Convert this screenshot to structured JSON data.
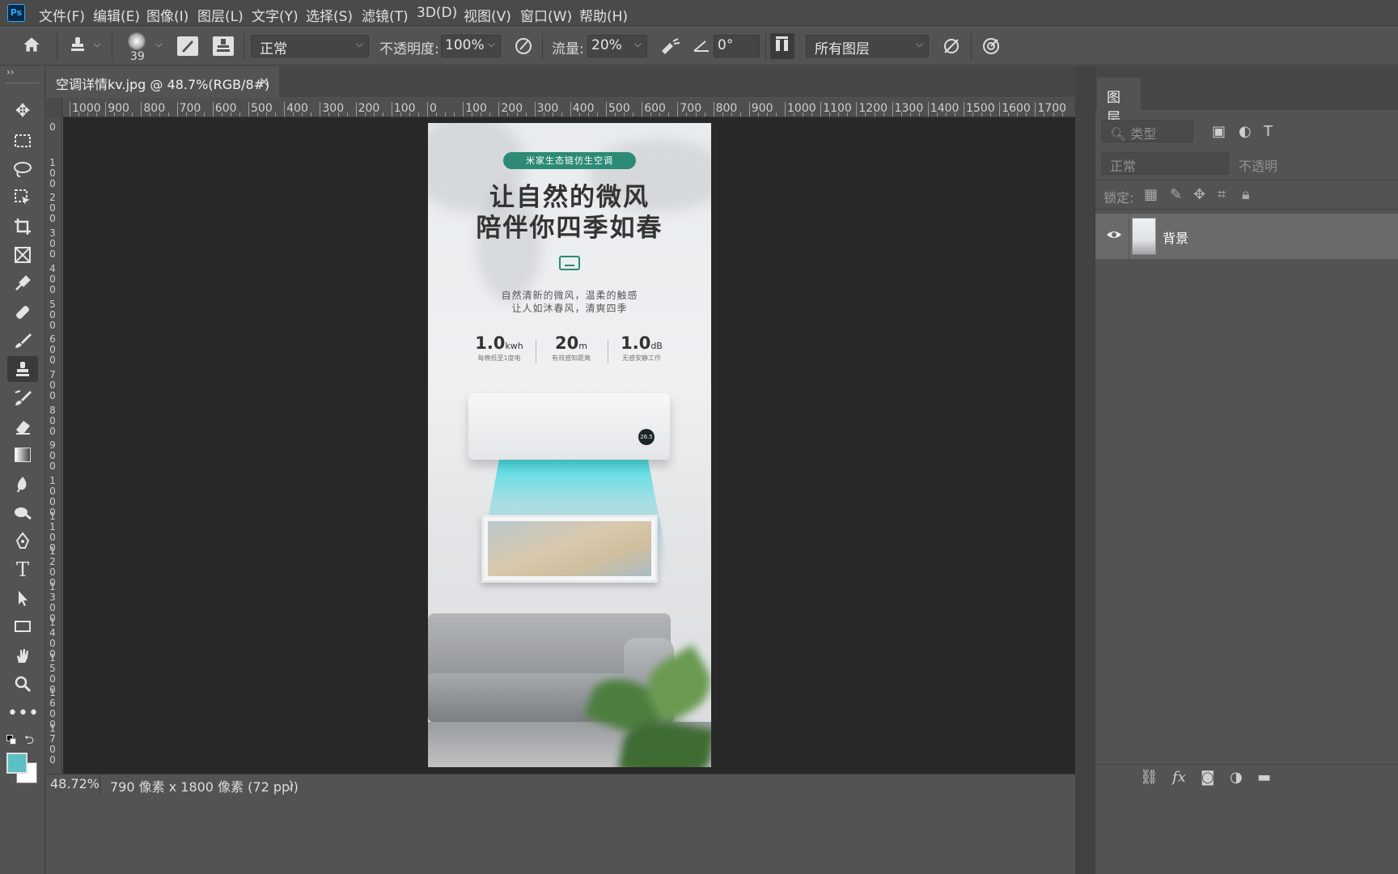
{
  "app": {
    "logo": "Ps",
    "accent": "#31a8ff"
  },
  "menu": [
    "文件(F)",
    "编辑(E)",
    "图像(I)",
    "图层(L)",
    "文字(Y)",
    "选择(S)",
    "滤镜(T)",
    "3D(D)",
    "视图(V)",
    "窗口(W)",
    "帮助(H)"
  ],
  "options": {
    "brush_size": "39",
    "mode": "正常",
    "opacity_label": "不透明度:",
    "opacity_value": "100%",
    "flow_label": "流量:",
    "flow_value": "20%",
    "angle_value": "0°",
    "sample": "所有图层"
  },
  "document": {
    "tab_title": "空调详情kv.jpg @ 48.7%(RGB/8#)",
    "close": "×"
  },
  "rulers": {
    "h_labels": [
      "1000",
      "900",
      "800",
      "700",
      "600",
      "500",
      "400",
      "300",
      "200",
      "100",
      "0",
      "100",
      "200",
      "300",
      "400",
      "500",
      "600",
      "700",
      "800",
      "900",
      "1000",
      "1100",
      "1200",
      "1300",
      "1400",
      "1500",
      "1600",
      "1700"
    ],
    "v_labels": [
      "0",
      "1\n0\n0",
      "2\n0\n0",
      "3\n0\n0",
      "4\n0\n0",
      "5\n0\n0",
      "6\n0\n0",
      "7\n0\n0",
      "8\n0\n0",
      "9\n0\n0",
      "1\n0\n0\n0",
      "1\n1\n0\n0",
      "1\n2\n0\n0",
      "1\n3\n0\n0",
      "1\n4\n0\n0",
      "1\n5\n0\n0",
      "1\n6\n0\n0",
      "1\n7\n0\n0"
    ]
  },
  "status": {
    "zoom": "48.72%",
    "info": "790 像素 x 1800 像素 (72 ppi)",
    "arrow": "〉"
  },
  "layers_panel": {
    "tab": "图层",
    "filter_placeholder": "类型",
    "blend_mode": "正常",
    "opacity_label": "不透明",
    "lock_label": "锁定:",
    "layers": [
      {
        "name": "背景",
        "visible": true
      }
    ]
  },
  "colors": {
    "foreground": "#5bbfc4",
    "background": "#ffffff"
  },
  "artwork": {
    "badge": "米家生态链仿生空调",
    "headline_1": "让自然的微风",
    "headline_2": "陪伴你四季如春",
    "sub_1": "自然清新的微风，温柔的触感",
    "sub_2": "让人如沐春风，清爽四季",
    "stats": [
      {
        "num": "1.0",
        "unit": "kwh",
        "caption": "每晚低至1度电"
      },
      {
        "num": "20",
        "unit": "m",
        "caption": "有效感知距离"
      },
      {
        "num": "1.0",
        "unit": "dB",
        "caption": "无感安静工作"
      }
    ],
    "display": "26.5"
  }
}
